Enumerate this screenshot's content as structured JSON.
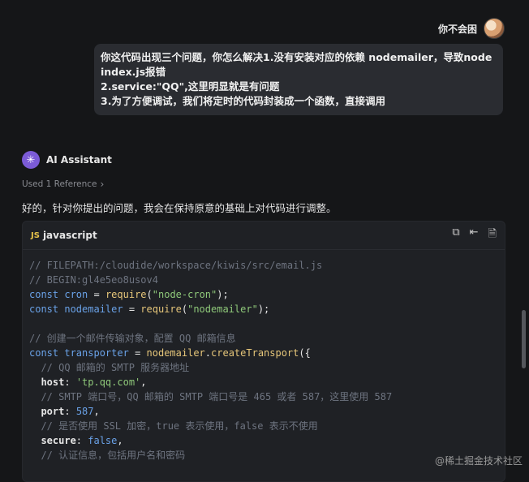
{
  "user": {
    "name": "你不会困",
    "message_lines": [
      "你这代码出现三个问题，你怎么解决1.没有安装对应的依赖 nodemailer，导致node",
      "index.js报错",
      "2.service:\"QQ\",这里明显就是有问题",
      "3.为了方便调试，我们将定时的代码封装成一个函数，直接调用"
    ]
  },
  "assistant": {
    "name": "AI Assistant",
    "reference": "Used 1 Reference",
    "reply": "好的，针对你提出的问题，我会在保持原意的基础上对代码进行调整。"
  },
  "code": {
    "badge": "JS",
    "language": "javascript",
    "actions": [
      "copy-icon",
      "insert-icon",
      "new-file-icon"
    ],
    "lines": [
      [
        [
          "c",
          "// FILEPATH:/cloudide/workspace/kiwis/src/email.js"
        ]
      ],
      [
        [
          "c",
          "// BEGIN:gl4e5eo8usov4"
        ]
      ],
      [
        [
          "k",
          "const "
        ],
        [
          "v",
          "cron"
        ],
        [
          "p",
          " = "
        ],
        [
          "f",
          "require"
        ],
        [
          "p",
          "("
        ],
        [
          "s",
          "\"node-cron\""
        ],
        [
          "p",
          ");"
        ]
      ],
      [
        [
          "k",
          "const "
        ],
        [
          "v",
          "nodemailer"
        ],
        [
          "p",
          " = "
        ],
        [
          "f",
          "require"
        ],
        [
          "p",
          "("
        ],
        [
          "s",
          "\"nodemailer\""
        ],
        [
          "p",
          ");"
        ]
      ],
      [
        [
          "p",
          ""
        ]
      ],
      [
        [
          "c",
          "// 创建一个邮件传输对象，配置 QQ 邮箱信息"
        ]
      ],
      [
        [
          "k",
          "const "
        ],
        [
          "v",
          "transporter"
        ],
        [
          "p",
          " = "
        ],
        [
          "f",
          "nodemailer"
        ],
        [
          "p",
          "."
        ],
        [
          "f",
          "createTransport"
        ],
        [
          "p",
          "({"
        ]
      ],
      [
        [
          "c",
          "  // QQ 邮箱的 SMTP 服务器地址"
        ]
      ],
      [
        [
          "r",
          "  host"
        ],
        [
          "p",
          ": "
        ],
        [
          "s",
          "'tp.qq.com'"
        ],
        [
          "p",
          ","
        ]
      ],
      [
        [
          "c",
          "  // SMTP 端口号，QQ 邮箱的 SMTP 端口号是 465 或者 587，这里使用 587"
        ]
      ],
      [
        [
          "r",
          "  port"
        ],
        [
          "p",
          ": "
        ],
        [
          "n",
          "587"
        ],
        [
          "p",
          ","
        ]
      ],
      [
        [
          "c",
          "  // 是否使用 SSL 加密，true 表示使用，false 表示不使用"
        ]
      ],
      [
        [
          "r",
          "  secure"
        ],
        [
          "p",
          ": "
        ],
        [
          "k",
          "false"
        ],
        [
          "p",
          ","
        ]
      ],
      [
        [
          "c",
          "  // 认证信息，包括用户名和密码"
        ]
      ]
    ]
  },
  "watermark": "@稀土掘金技术社区"
}
